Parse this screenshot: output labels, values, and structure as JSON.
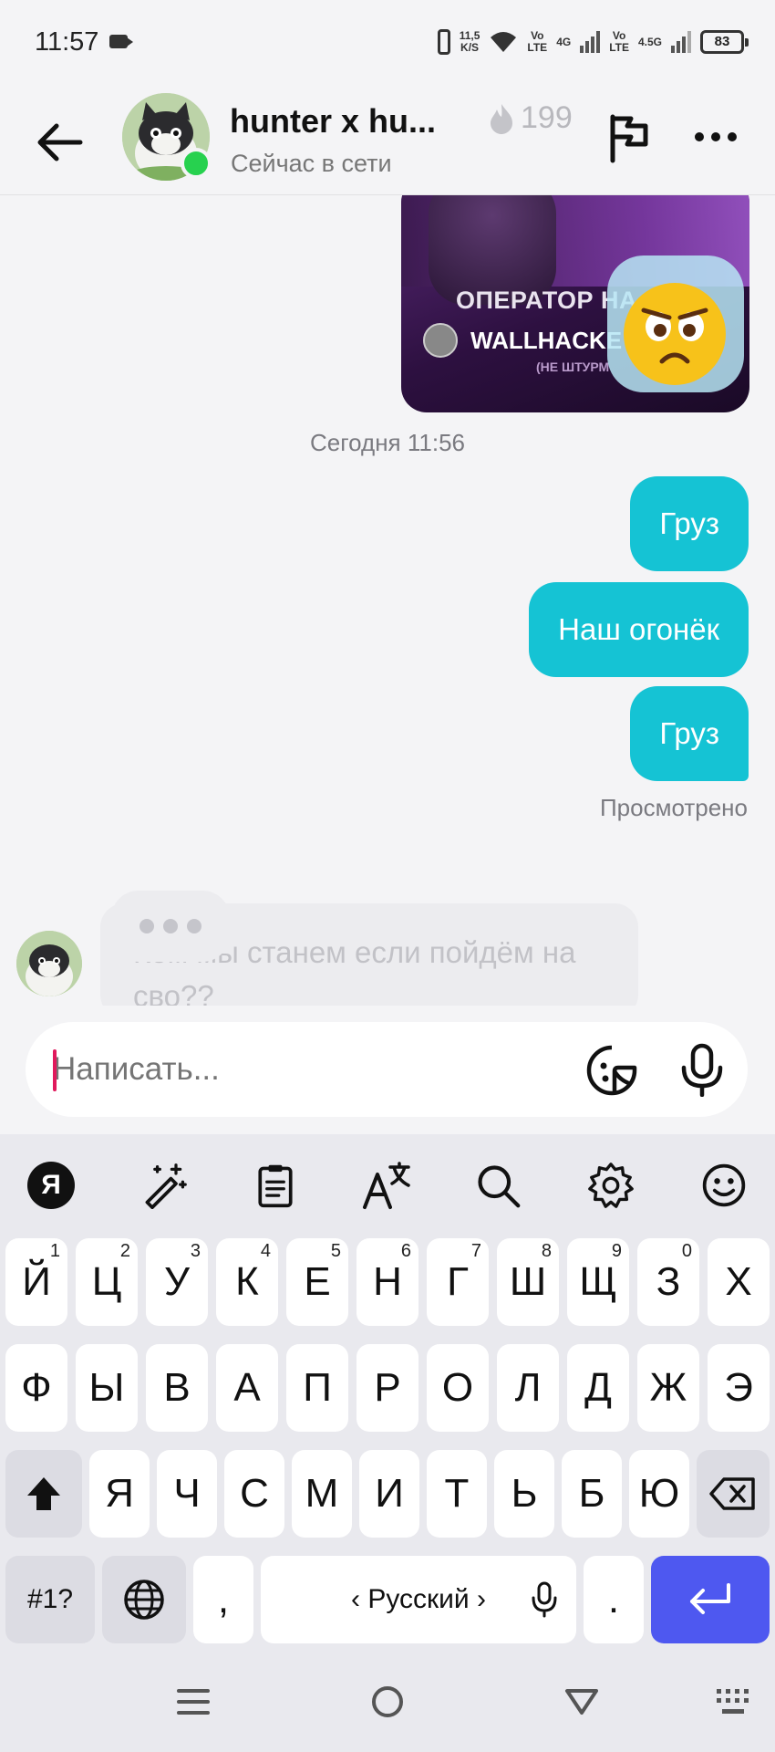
{
  "status_bar": {
    "time": "11:57",
    "speed_value": "11,5",
    "speed_unit": "K/S",
    "net1_top": "Vo",
    "net1_bottom": "LTE",
    "net1_gen": "4G",
    "net2_top": "Vo",
    "net2_bottom": "LTE",
    "net2_gen": "4.5G",
    "battery": "83"
  },
  "header": {
    "title": "hunter x hu...",
    "status": "Сейчас в сети",
    "streak_count": "199"
  },
  "chat": {
    "media": {
      "caption": "ОПЕРАТОР НА С",
      "channel": "WALLHACKE",
      "sub": "(НЕ ШТУРМ"
    },
    "date_separator": "Сегодня 11:56",
    "messages": [
      {
        "text": "Груз"
      },
      {
        "text": "Наш огонёк"
      },
      {
        "text": "Груз"
      }
    ],
    "seen_label": "Просмотрено",
    "incoming_preview": "Кем мы станем если пойдём на сво??"
  },
  "composer": {
    "placeholder": "Написать..."
  },
  "keyboard": {
    "logo": "Я",
    "row1": [
      {
        "k": "Й",
        "h": "1"
      },
      {
        "k": "Ц",
        "h": "2"
      },
      {
        "k": "У",
        "h": "3"
      },
      {
        "k": "К",
        "h": "4"
      },
      {
        "k": "Е",
        "h": "5"
      },
      {
        "k": "Н",
        "h": "6"
      },
      {
        "k": "Г",
        "h": "7"
      },
      {
        "k": "Ш",
        "h": "8"
      },
      {
        "k": "Щ",
        "h": "9"
      },
      {
        "k": "З",
        "h": "0"
      },
      {
        "k": "Х",
        "h": ""
      }
    ],
    "row2": [
      "Ф",
      "Ы",
      "В",
      "А",
      "П",
      "Р",
      "О",
      "Л",
      "Д",
      "Ж",
      "Э"
    ],
    "row3": [
      "Я",
      "Ч",
      "С",
      "М",
      "И",
      "Т",
      "Ь",
      "Б",
      "Ю"
    ],
    "symbols_label": "#1?",
    "comma": ",",
    "space_label": "‹  Русский  ›",
    "period": "."
  },
  "colors": {
    "bubble": "#15c3d4",
    "online": "#27d14f",
    "enter_key": "#4e58f0",
    "cursor": "#e0195c"
  }
}
